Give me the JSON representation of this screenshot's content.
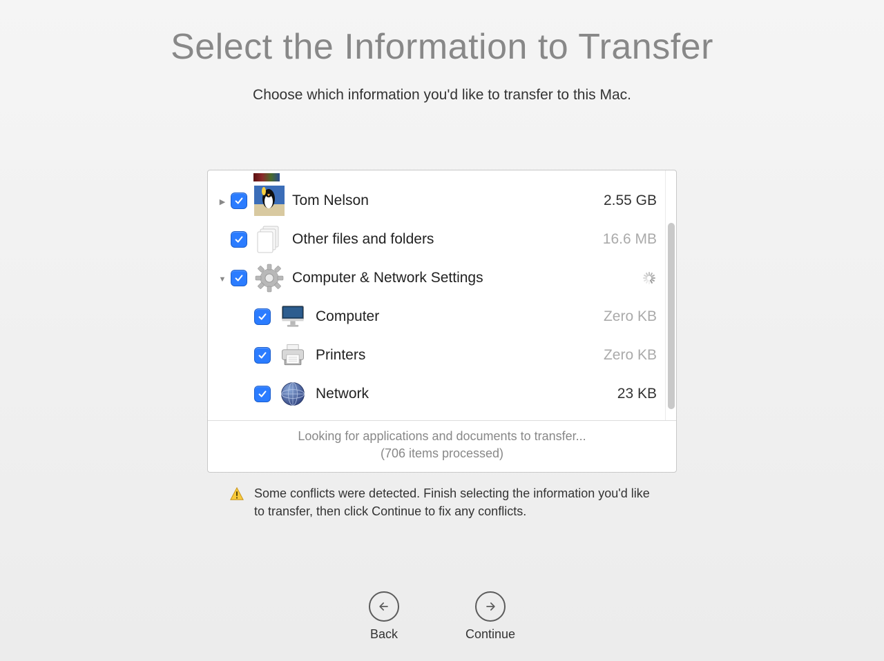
{
  "title": "Select the Information to Transfer",
  "subtitle": "Choose which information you'd like to transfer to this Mac.",
  "items": [
    {
      "label": "Tom Nelson",
      "size": "2.55 GB",
      "dim": false,
      "checked": true,
      "disclosure": "right",
      "indent": 0,
      "icon": "penguin"
    },
    {
      "label": "Other files and folders",
      "size": "16.6 MB",
      "dim": true,
      "checked": true,
      "disclosure": "none",
      "indent": 0,
      "icon": "documents"
    },
    {
      "label": "Computer & Network Settings",
      "size": "spinner",
      "dim": true,
      "checked": true,
      "disclosure": "down",
      "indent": 0,
      "icon": "gear"
    },
    {
      "label": "Computer",
      "size": "Zero KB",
      "dim": true,
      "checked": true,
      "disclosure": "none",
      "indent": 1,
      "icon": "imac"
    },
    {
      "label": "Printers",
      "size": "Zero KB",
      "dim": true,
      "checked": true,
      "disclosure": "none",
      "indent": 1,
      "icon": "printer"
    },
    {
      "label": "Network",
      "size": "23 KB",
      "dim": false,
      "checked": true,
      "disclosure": "none",
      "indent": 1,
      "icon": "network"
    }
  ],
  "status": {
    "line1": "Looking for applications and documents to transfer...",
    "line2": "(706 items processed)"
  },
  "warning": "Some conflicts were detected. Finish selecting the information you'd like to transfer, then click Continue to fix any conflicts.",
  "buttons": {
    "back": "Back",
    "continue": "Continue"
  }
}
